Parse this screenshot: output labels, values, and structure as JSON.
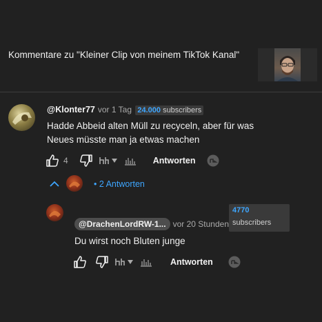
{
  "header": {
    "title": "Kommentare zu \"Kleiner Clip von meinem TikTok Kanal\""
  },
  "comment": {
    "author": "@Klonter77",
    "time": "vor 1 Tag",
    "subs_count": "24.000",
    "subs_label": "subscribers",
    "text_line1": "Hadde Abbeid alten Müll zu recyceln, aber für was",
    "text_line2": "Neues  müsste man ja etwas machen",
    "likes": "4",
    "reply_label": "Antworten"
  },
  "replies_toggle": {
    "label": "• 2 Antworten"
  },
  "reply": {
    "author": "@DrachenLordRW-1...",
    "time": "vor 20 Stunden",
    "subs_count": "4770",
    "subs_label": "subscribers",
    "text": "Du wirst noch Bluten junge",
    "reply_label": "Antworten"
  },
  "colors": {
    "background": "#212121",
    "link": "#3ea6ff",
    "text": "#f1f1f1",
    "muted": "#aaaaaa"
  }
}
